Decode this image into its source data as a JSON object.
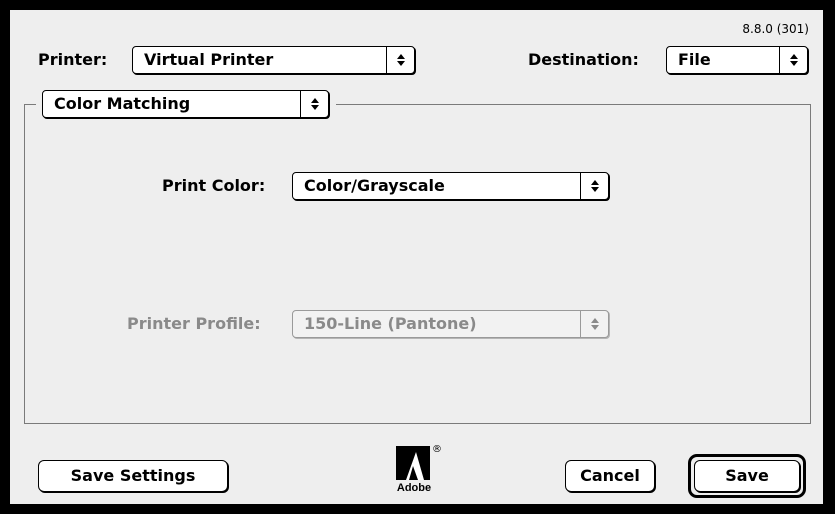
{
  "version": "8.8.0 (301)",
  "printer": {
    "label": "Printer:",
    "value": "Virtual Printer"
  },
  "destination": {
    "label": "Destination:",
    "value": "File"
  },
  "panel_menu": {
    "value": "Color Matching"
  },
  "print_color": {
    "label": "Print Color:",
    "value": "Color/Grayscale"
  },
  "printer_profile": {
    "label": "Printer Profile:",
    "value": "150-Line (Pantone)",
    "enabled": false
  },
  "buttons": {
    "save_settings": "Save Settings",
    "cancel": "Cancel",
    "save": "Save"
  },
  "logo": {
    "brand": "Adobe",
    "mark": "®"
  },
  "colors": {
    "dialog_bg": "#eeeeee",
    "disabled_text": "#8a8a8a"
  }
}
